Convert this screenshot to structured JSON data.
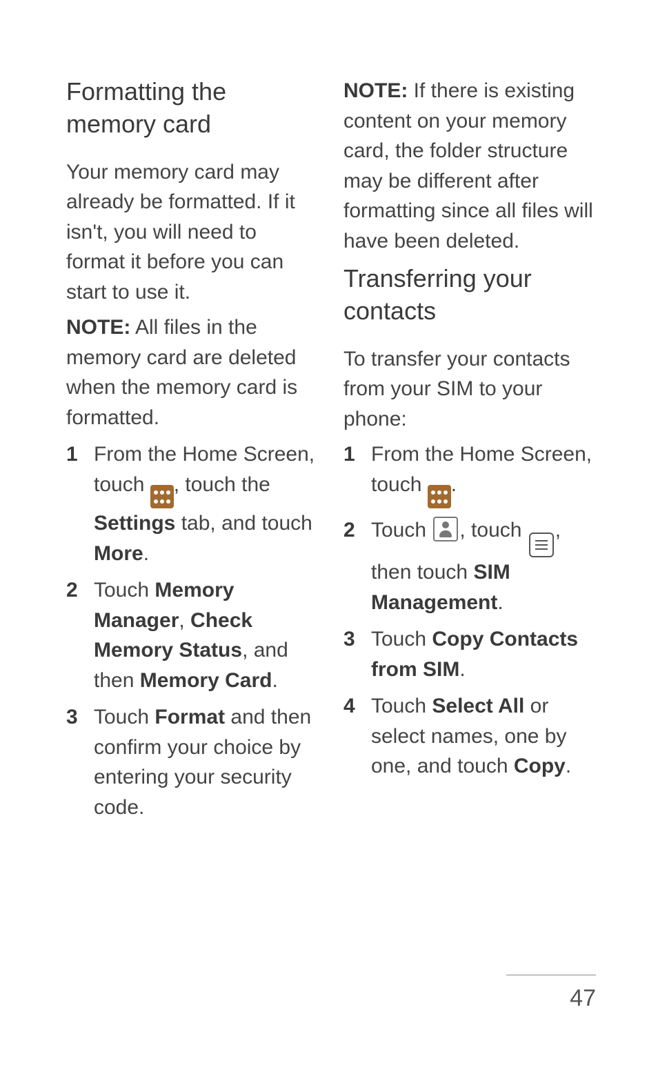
{
  "page_number": "47",
  "left": {
    "heading": "Formatting the memory card",
    "intro": "Your memory card may already be formatted. If it isn't, you will need to format it before you can start to use it.",
    "note_label": "NOTE:",
    "note_body": " All files in the memory card are deleted when the memory card is formatted.",
    "steps": {
      "s1a": "From the Home Screen, touch ",
      "s1b": ", touch the ",
      "s1_settings": "Settings",
      "s1c": " tab, and touch ",
      "s1_more": "More",
      "s1d": ".",
      "s2a": "Touch ",
      "s2_memory_manager": "Memory Manager",
      "s2b": ", ",
      "s2_check": "Check Memory Status",
      "s2c": ", and then ",
      "s2_card": "Memory Card",
      "s2d": ".",
      "s3a": "Touch ",
      "s3_format": "Format",
      "s3b": " and then confirm your choice by entering your security code."
    }
  },
  "right": {
    "note_label": "NOTE:",
    "note_body": " If there is existing content on your memory card, the folder structure may be different after formatting since all files will have been deleted.",
    "heading": "Transferring your contacts",
    "intro": "To transfer your contacts from your SIM to your phone:",
    "steps": {
      "s1a": "From the Home Screen, touch ",
      "s1b": ".",
      "s2a": "Touch ",
      "s2b": ", touch ",
      "s2c": ", then touch ",
      "s2_sim": "SIM Management",
      "s2d": ".",
      "s3a": "Touch ",
      "s3_copy_contacts": "Copy Contacts from SIM",
      "s3b": ".",
      "s4a": "Touch ",
      "s4_select_all": "Select All",
      "s4b": " or select names, one by one, and touch ",
      "s4_copy": "Copy",
      "s4c": "."
    }
  }
}
